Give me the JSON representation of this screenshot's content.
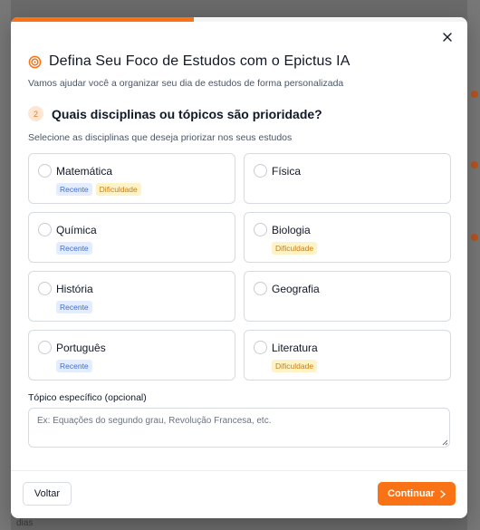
{
  "modal": {
    "progress_percent": 40,
    "close_label": "×",
    "title": "Defina Seu Foco de Estudos com o Epictus IA",
    "subtitle": "Vamos ajudar você a organizar seu dia de estudos de forma personalizada",
    "accent_color": "#f97316"
  },
  "step": {
    "number": "2",
    "title": "Quais disciplinas ou tópicos são prioridade?",
    "help": "Selecione as disciplinas que deseja priorizar nos seus estudos"
  },
  "subjects": [
    {
      "label": "Matemática",
      "tags": [
        {
          "text": "Recente",
          "kind": "recent"
        },
        {
          "text": "Dificuldade",
          "kind": "diff"
        }
      ]
    },
    {
      "label": "Física",
      "tags": []
    },
    {
      "label": "Química",
      "tags": [
        {
          "text": "Recente",
          "kind": "recent"
        }
      ]
    },
    {
      "label": "Biologia",
      "tags": [
        {
          "text": "Dificuldade",
          "kind": "diff"
        }
      ]
    },
    {
      "label": "História",
      "tags": [
        {
          "text": "Recente",
          "kind": "recent"
        }
      ]
    },
    {
      "label": "Geografia",
      "tags": []
    },
    {
      "label": "Português",
      "tags": [
        {
          "text": "Recente",
          "kind": "recent"
        }
      ]
    },
    {
      "label": "Literatura",
      "tags": [
        {
          "text": "Dificuldade",
          "kind": "diff"
        }
      ]
    }
  ],
  "topic": {
    "label": "Tópico específico (opcional)",
    "placeholder": "Ex: Equações do segundo grau, Revolução Francesa, etc.",
    "value": ""
  },
  "footer": {
    "back_label": "Voltar",
    "continue_label": "Continuar",
    "continue_icon": "chevron-right-icon"
  },
  "background": {
    "bottom_text": "dias"
  }
}
